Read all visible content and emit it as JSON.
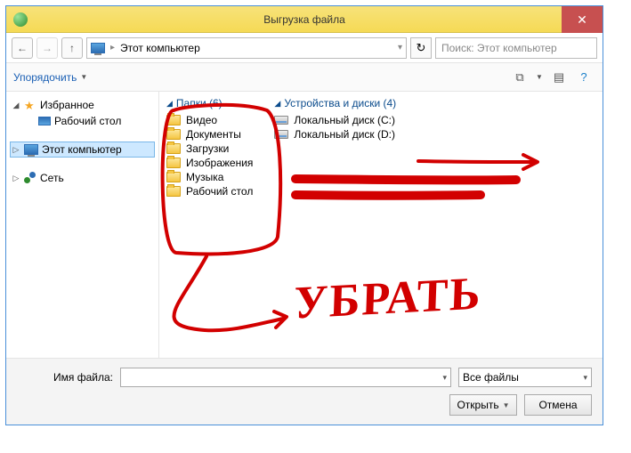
{
  "window": {
    "title": "Выгрузка файла",
    "close_glyph": "✕"
  },
  "nav": {
    "back_glyph": "←",
    "fwd_glyph": "→",
    "up_glyph": "↑",
    "breadcrumb_sep": "▸",
    "location": "Этот компьютер",
    "addr_drop": "▾",
    "refresh_glyph": "↻",
    "search_placeholder": "Поиск: Этот компьютер",
    "search_glyph": "🔍"
  },
  "toolbar": {
    "organize": "Упорядочить",
    "drop": "▼",
    "view_tiles": "⧉",
    "view_drop": "▼",
    "view_details": "▤",
    "help": "?"
  },
  "tree": {
    "favorites": {
      "twisty": "◢",
      "label": "Избранное"
    },
    "desktop": {
      "label": "Рабочий стол"
    },
    "this_pc": {
      "twisty": "▷",
      "label": "Этот компьютер"
    },
    "network": {
      "twisty": "▷",
      "label": "Сеть"
    }
  },
  "content": {
    "folders_header": "Папки (6)",
    "folders": [
      {
        "label": "Видео"
      },
      {
        "label": "Документы"
      },
      {
        "label": "Загрузки"
      },
      {
        "label": "Изображения"
      },
      {
        "label": "Музыка"
      },
      {
        "label": "Рабочий стол"
      }
    ],
    "devices_header": "Устройства и диски (4)",
    "devices": [
      {
        "label": "Локальный диск (C:)"
      },
      {
        "label": "Локальный диск (D:)"
      }
    ]
  },
  "footer": {
    "filename_label": "Имя файла:",
    "filename_value": "",
    "filetype": "Все файлы",
    "open": "Открыть",
    "cancel": "Отмена",
    "drop": "▾"
  },
  "annotation": {
    "text": "УБРАТЬ"
  }
}
